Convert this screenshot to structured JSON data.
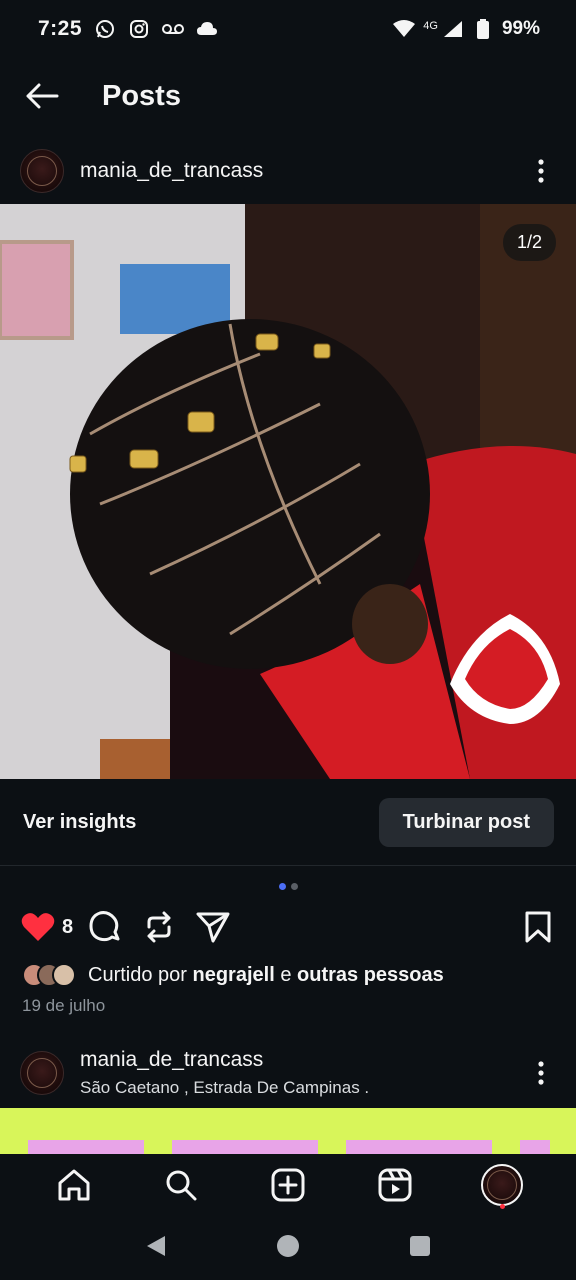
{
  "status_bar": {
    "time": "7:25",
    "network": "4G",
    "battery": "99%",
    "left_icons": [
      "whatsapp-icon",
      "instagram-icon",
      "voicemail-icon",
      "cloud-icon"
    ],
    "right_icons": [
      "wifi-icon",
      "signal-icon",
      "battery-icon"
    ]
  },
  "header": {
    "title": "Posts"
  },
  "post": {
    "username": "mania_de_trancass",
    "photo_counter": "1/2",
    "carousel": {
      "total": 2,
      "current": 1
    },
    "insights_label": "Ver insights",
    "boost_label": "Turbinar post",
    "like_count": "8",
    "liked_prefix": "Curtido por ",
    "liked_user": "negrajell",
    "liked_middle": " e ",
    "liked_others": "outras pessoas",
    "date": "19 de julho"
  },
  "next_post": {
    "username": "mania_de_trancass",
    "location": "São Caetano , Estrada De Campinas ."
  },
  "colors": {
    "background": "#0c1014",
    "like_red": "#ff3040",
    "active_dot": "#4c6ef5",
    "preview_lime": "#d8f55a",
    "preview_pink": "#e8a4e8"
  }
}
